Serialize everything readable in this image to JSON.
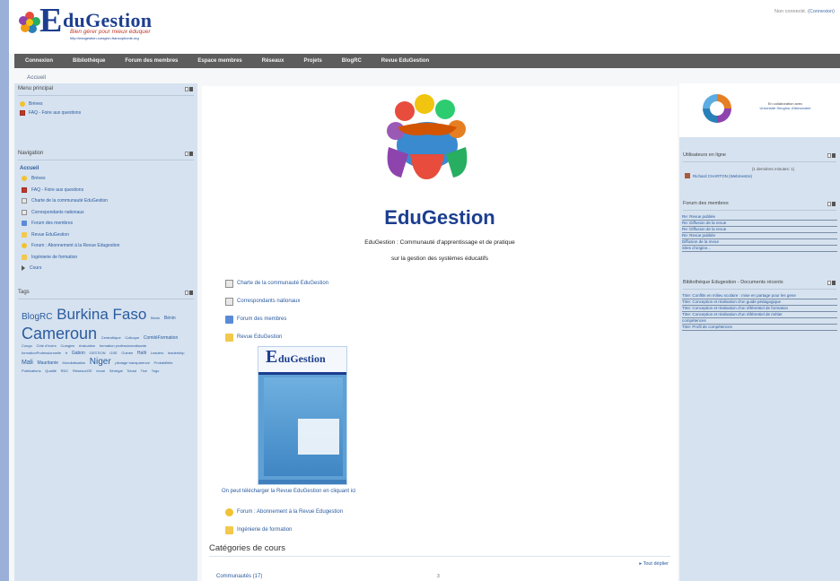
{
  "header": {
    "logo_letter": "E",
    "logo_name": "duGestion",
    "logo_tagline": "Bien gérer pour mieux éduquer",
    "logo_url": "http://edugestion.cursgivn.francophonie.org",
    "login_text": "Non connecté.",
    "login_link": "(Connexion)"
  },
  "nav": {
    "items": [
      "Connexion",
      "Bibliothèque",
      "Forum des membres",
      "Espace membres",
      "Réseaux",
      "Projets",
      "BlogRC",
      "Revue EduGestion"
    ]
  },
  "breadcrumb": "Accueil",
  "left": {
    "main_menu": {
      "title": "Menu principal",
      "items": [
        {
          "label": "Brèves",
          "icon": "bubble-icon"
        },
        {
          "label": "FAQ - Foire aux questions",
          "icon": "faq-icon"
        }
      ]
    },
    "navigation": {
      "title": "Navigation",
      "root": "Accueil",
      "items": [
        {
          "label": "Brèves",
          "icon": "bubble-icon"
        },
        {
          "label": "FAQ - Foire aux questions",
          "icon": "faq-icon"
        },
        {
          "label": "Charte de la communauté EduGestion",
          "icon": "document-icon"
        },
        {
          "label": "Correspondants nationaux",
          "icon": "document-icon"
        },
        {
          "label": "Forum des membres",
          "icon": "forum-icon"
        },
        {
          "label": "Revue EduGestion",
          "icon": "folder-icon"
        },
        {
          "label": "Forum : Abonnement à la Revue Edugestion",
          "icon": "bubble-icon"
        },
        {
          "label": "Ingénierie de formation",
          "icon": "folder-icon"
        },
        {
          "label": "Cours",
          "icon": "arrow-icon"
        }
      ]
    },
    "tags": {
      "title": "Tags",
      "items": [
        {
          "label": "BlogRC",
          "size": "t-l"
        },
        {
          "label": "Burkina Faso",
          "size": "t-xl"
        },
        {
          "label": "Benin",
          "size": "t-xs"
        },
        {
          "label": "Bénin",
          "size": "t-s"
        },
        {
          "label": "Cameroun",
          "size": "t-xxl"
        },
        {
          "label": "Centrafrique",
          "size": "t-xs"
        },
        {
          "label": "Colloque",
          "size": "t-xs"
        },
        {
          "label": "ComitéFormation",
          "size": "t-s"
        },
        {
          "label": "Congo",
          "size": "t-xs"
        },
        {
          "label": "Côte d'Ivoire",
          "size": "t-xs"
        },
        {
          "label": "Cursgivn",
          "size": "t-xs"
        },
        {
          "label": "évaluation",
          "size": "t-xs"
        },
        {
          "label": "formation professionnalisante",
          "size": "t-xs"
        },
        {
          "label": "formationProfessionnelle",
          "size": "t-xs"
        },
        {
          "label": "fr",
          "size": "t-xs"
        },
        {
          "label": "Gabon",
          "size": "t-s"
        },
        {
          "label": "GESTION",
          "size": "t-xs"
        },
        {
          "label": "GSE",
          "size": "t-xs"
        },
        {
          "label": "Guinée",
          "size": "t-xs"
        },
        {
          "label": "Haïti",
          "size": "t-s"
        },
        {
          "label": "Leaders",
          "size": "t-xs"
        },
        {
          "label": "leadership",
          "size": "t-xs"
        },
        {
          "label": "Mali",
          "size": "t-m"
        },
        {
          "label": "Mauritanie",
          "size": "t-s"
        },
        {
          "label": "Mondialisation",
          "size": "t-xs"
        },
        {
          "label": "Niger",
          "size": "t-l"
        },
        {
          "label": "pilotage transparence",
          "size": "t-xs"
        },
        {
          "label": "Probabilités",
          "size": "t-xs"
        },
        {
          "label": "Publications",
          "size": "t-xs"
        },
        {
          "label": "Qualité",
          "size": "t-xs"
        },
        {
          "label": "RDC",
          "size": "t-xs"
        },
        {
          "label": "RéseauxGE",
          "size": "t-xs"
        },
        {
          "label": "revue",
          "size": "t-xs"
        },
        {
          "label": "Sénégal",
          "size": "t-xs"
        },
        {
          "label": "Tchad",
          "size": "t-xs"
        },
        {
          "label": "Tice",
          "size": "t-xs"
        },
        {
          "label": "Togo",
          "size": "t-xs"
        }
      ]
    }
  },
  "center": {
    "site_title": "EduGestion",
    "subtitle_line1": "EduGestion : Communauté d'apprentissage et de pratique",
    "subtitle_line2": "sur la gestion des systèmes éducatifs",
    "links": [
      {
        "label": "Charte de la communauté EduGestion",
        "icon": "document-icon"
      },
      {
        "label": "Correspondants nationaux",
        "icon": "document-icon"
      },
      {
        "label": "Forum des membres",
        "icon": "forum-icon"
      },
      {
        "label": "Revue EduGestion",
        "icon": "folder-icon"
      }
    ],
    "cover": {
      "letter": "E",
      "name": "duGestion"
    },
    "download_text": "On peut télécharger la Revue EduGestion en cliquant ici",
    "links2": [
      {
        "label": "Forum : Abonnement à la Revue Edugestion",
        "icon": "bubble-icon"
      },
      {
        "label": "Ingénierie de formation",
        "icon": "folder-icon"
      }
    ],
    "categories_title": "Catégories de cours",
    "expand_all": "▸ Tout déplier",
    "category": {
      "label": "Communautés (17)",
      "count": "3"
    }
  },
  "right": {
    "collab_line1": "En collaboration avec",
    "collab_line2": "Université Senghor d'Alexandrie",
    "online": {
      "title": "Utilisateurs en ligne",
      "meta": "(1 dernières minutes: 1)",
      "user": "Richard CHARTON (Webmestre)"
    },
    "forum": {
      "title": "Forum des membres",
      "items": [
        "Re: Revue publiée",
        "Re: Diffusion de la revue",
        "Re: Diffusion de la revue",
        "Re: Revue publiée",
        "Diffusion de la revue",
        "Sites d'origine..."
      ]
    },
    "library": {
      "title": "Bibliothèque Edugestion - Documents récents",
      "items": [
        "Titre: Conflits en milieu scolaire : mise en partage pour les gene",
        "Titre: Conception et réalisation d'un guide pédagogique",
        "Titre: Conception et réalisation d'un référentiel de formation",
        "Titre: Conception et réalisation d'un référentiel de métier",
        "compétences",
        "Titre: Profil de compétences"
      ]
    }
  },
  "colors": {
    "brand_blue": "#1c3e8f",
    "nav_bg": "#5d5d5d",
    "sidebar_bg": "#d6e2ef",
    "link": "#2a5b9f"
  }
}
